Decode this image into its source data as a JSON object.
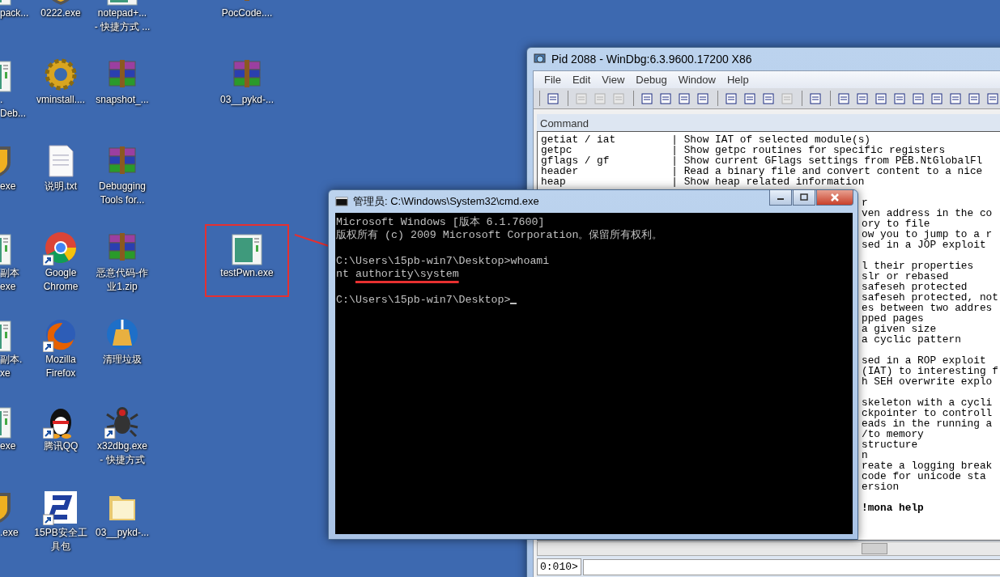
{
  "desktop": {
    "columns": [
      {
        "icons": [
          {
            "kind": "app",
            "lines": [
              "pack..."
            ]
          },
          {
            "kind": "app",
            "lines": [
              ".",
              "Deb..."
            ]
          },
          {
            "kind": "shield",
            "lines": [
              "exe"
            ]
          },
          {
            "kind": "app",
            "lines": [
              "副本",
              "exe"
            ]
          },
          {
            "kind": "app",
            "lines": [
              "副本.",
              "xe"
            ]
          },
          {
            "kind": "app",
            "lines": [
              "exe"
            ]
          },
          {
            "kind": "shield",
            "lines": [
              ".exe"
            ]
          }
        ]
      },
      {
        "icons": [
          {
            "kind": "shield",
            "lines": [
              "0222.exe"
            ],
            "shortcut": false
          },
          {
            "kind": "gear",
            "lines": [
              "vminstall...."
            ],
            "shortcut": false
          },
          {
            "kind": "text",
            "lines": [
              "说明.txt"
            ],
            "shortcut": false
          },
          {
            "kind": "chrome",
            "lines": [
              "Google",
              "Chrome"
            ],
            "shortcut": true
          },
          {
            "kind": "firefox",
            "lines": [
              "Mozilla",
              "Firefox"
            ],
            "shortcut": true
          },
          {
            "kind": "penguin",
            "lines": [
              "腾讯QQ"
            ],
            "shortcut": true
          },
          {
            "kind": "logo",
            "lines": [
              "15PB安全工",
              "具包"
            ],
            "shortcut": true
          }
        ]
      },
      {
        "icons": [
          {
            "kind": "app",
            "lines": [
              "notepad+...",
              "- 快捷方式 ..."
            ],
            "shortcut": false
          },
          {
            "kind": "archive",
            "lines": [
              "snapshot_..."
            ],
            "shortcut": false
          },
          {
            "kind": "archive",
            "lines": [
              "Debugging",
              "Tools for..."
            ],
            "shortcut": false
          },
          {
            "kind": "archive",
            "lines": [
              "恶意代码-作",
              "业1.zip"
            ],
            "shortcut": false
          },
          {
            "kind": "broom",
            "lines": [
              "清理垃圾"
            ],
            "shortcut": false
          },
          {
            "kind": "bug",
            "lines": [
              "x32dbg.exe",
              "- 快捷方式"
            ],
            "shortcut": true
          },
          {
            "kind": "folder",
            "lines": [
              "03__pykd-..."
            ],
            "shortcut": false
          }
        ]
      },
      {
        "icons": [
          {
            "kind": "archive",
            "lines": [
              "PocCode...."
            ],
            "shortcut": false
          },
          {
            "kind": "archive",
            "lines": [
              "03__pykd-..."
            ],
            "shortcut": false
          },
          {
            "kind": "app",
            "lines": [
              "testPwn.exe"
            ],
            "shortcut": false,
            "framed": true
          }
        ]
      }
    ]
  },
  "windbg": {
    "title": "Pid 2088 - WinDbg:6.3.9600.17200 X86",
    "menu": [
      "File",
      "Edit",
      "View",
      "Debug",
      "Window",
      "Help"
    ],
    "toolbar": [
      [
        {
          "disabled": false
        }
      ],
      [
        {
          "disabled": true
        },
        {
          "disabled": true
        },
        {
          "disabled": true
        }
      ],
      [
        {
          "disabled": false
        },
        {
          "disabled": false
        },
        {
          "disabled": false
        },
        {
          "disabled": false
        }
      ],
      [
        {
          "disabled": false
        },
        {
          "disabled": false
        },
        {
          "disabled": false
        },
        {
          "disabled": true
        }
      ],
      [
        {
          "disabled": false
        }
      ],
      [
        {
          "disabled": false
        },
        {
          "disabled": false
        },
        {
          "disabled": false
        },
        {
          "disabled": false
        },
        {
          "disabled": false
        },
        {
          "disabled": false
        },
        {
          "disabled": false
        },
        {
          "disabled": false
        },
        {
          "disabled": false
        }
      ]
    ],
    "pane_title": "Command",
    "lines": [
      {
        "kind": "full",
        "text": "getiat / iat         | Show IAT of selected module(s)"
      },
      {
        "kind": "full",
        "text": "getpc                | Show getpc routines for specific registers"
      },
      {
        "kind": "full",
        "text": "gflags / gf          | Show current GFlags settings from PEB.NtGlobalFl"
      },
      {
        "kind": "full",
        "text": "header               | Read a binary file and convert content to a nice"
      },
      {
        "kind": "full",
        "text": "heap                 | Show heap related information"
      },
      {
        "kind": "blank"
      },
      {
        "kind": "fragment",
        "text": "r"
      },
      {
        "kind": "fragment",
        "text": "ven address in the co"
      },
      {
        "kind": "fragment",
        "text": "ory to file"
      },
      {
        "kind": "fragment",
        "text": "ow you to jump to a r"
      },
      {
        "kind": "fragment",
        "text": "sed in a JOP exploit"
      },
      {
        "kind": "blank"
      },
      {
        "kind": "fragment",
        "text": "l their properties"
      },
      {
        "kind": "fragment",
        "text": "slr or rebased"
      },
      {
        "kind": "fragment",
        "text": "safeseh protected"
      },
      {
        "kind": "fragment",
        "text": "safeseh protected, not"
      },
      {
        "kind": "fragment",
        "text": "es between two addres"
      },
      {
        "kind": "fragment",
        "text": "pped pages"
      },
      {
        "kind": "fragment",
        "text": "a given size"
      },
      {
        "kind": "fragment",
        "text": "a cyclic pattern"
      },
      {
        "kind": "blank"
      },
      {
        "kind": "fragment",
        "text": "sed in a ROP exploit"
      },
      {
        "kind": "fragment",
        "text": "(IAT) to interesting f"
      },
      {
        "kind": "fragment",
        "text": "h SEH overwrite explo"
      },
      {
        "kind": "blank"
      },
      {
        "kind": "fragment",
        "text": "skeleton with a cycli"
      },
      {
        "kind": "fragment",
        "text": "ckpointer to controll"
      },
      {
        "kind": "fragment",
        "text": "eads in the running a"
      },
      {
        "kind": "fragment",
        "text": "/to memory"
      },
      {
        "kind": "fragment",
        "text": "structure"
      },
      {
        "kind": "fragment",
        "text": "n"
      },
      {
        "kind": "fragment",
        "text": "reate a logging break"
      },
      {
        "kind": "fragment",
        "text": "code for unicode sta"
      },
      {
        "kind": "fragment",
        "text": "ersion"
      },
      {
        "kind": "blank"
      },
      {
        "kind": "bold",
        "text": "!mona help"
      }
    ],
    "prompt": "0:010>"
  },
  "cmd": {
    "title": "管理员: C:\\Windows\\System32\\cmd.exe",
    "lines": [
      {
        "kind": "text",
        "text": "Microsoft Windows [版本 6.1.7600]"
      },
      {
        "kind": "text",
        "text": "版权所有 (c) 2009 Microsoft Corporation。保留所有权利。"
      },
      {
        "kind": "blank"
      },
      {
        "kind": "text",
        "text": "C:\\Users\\15pb-win7\\Desktop>whoami"
      },
      {
        "kind": "text",
        "text": "nt ",
        "marked": "authority\\system"
      },
      {
        "kind": "blank"
      },
      {
        "kind": "text",
        "text": "C:\\Users\\15pb-win7\\Desktop>",
        "cursor": true
      }
    ]
  }
}
